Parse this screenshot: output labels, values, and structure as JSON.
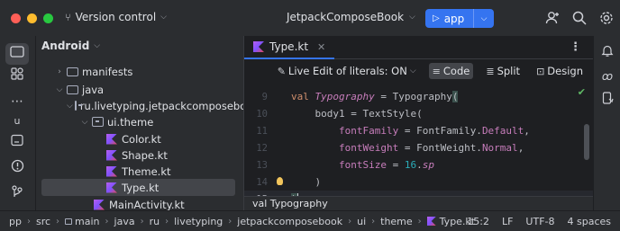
{
  "titlebar": {
    "vcs_label": "Version control",
    "project_name": "JetpackComposeBook",
    "run_config": "app",
    "colors": {
      "red": "#ff5f57",
      "yellow": "#febc2e",
      "green": "#28c840",
      "accent": "#3574f0"
    }
  },
  "project_panel": {
    "title": "Android",
    "tree": [
      {
        "label": "manifests",
        "depth": 1,
        "kind": "folder",
        "expanded": false
      },
      {
        "label": "java",
        "depth": 1,
        "kind": "folder",
        "expanded": true
      },
      {
        "label": "ru.livetyping.jetpackcomposebook",
        "depth": 2,
        "kind": "package",
        "expanded": true
      },
      {
        "label": "ui.theme",
        "depth": 3,
        "kind": "package",
        "expanded": true
      },
      {
        "label": "Color.kt",
        "depth": 4,
        "kind": "kotlin"
      },
      {
        "label": "Shape.kt",
        "depth": 4,
        "kind": "kotlin"
      },
      {
        "label": "Theme.kt",
        "depth": 4,
        "kind": "kotlin"
      },
      {
        "label": "Type.kt",
        "depth": 4,
        "kind": "kotlin",
        "selected": true
      },
      {
        "label": "MainActivity.kt",
        "depth": 3,
        "kind": "kotlin"
      }
    ]
  },
  "editor": {
    "tab_label": "Type.kt",
    "live_edit": "Live Edit of literals: ON",
    "view_modes": [
      "Code",
      "Split",
      "Design"
    ],
    "active_view": "Code",
    "gutter": [
      "9",
      "10",
      "11",
      "12",
      "13",
      "14",
      "15"
    ],
    "current_line": "15",
    "bottom_hint": "val Typography"
  },
  "status_bar": {
    "breadcrumbs": [
      "pp",
      "src",
      "main",
      "java",
      "ru",
      "livetyping",
      "jetpackcomposebook",
      "ui",
      "theme",
      "Type.kt"
    ],
    "position": "15:2",
    "line_sep": "LF",
    "encoding": "UTF-8",
    "indent": "4 spaces"
  }
}
